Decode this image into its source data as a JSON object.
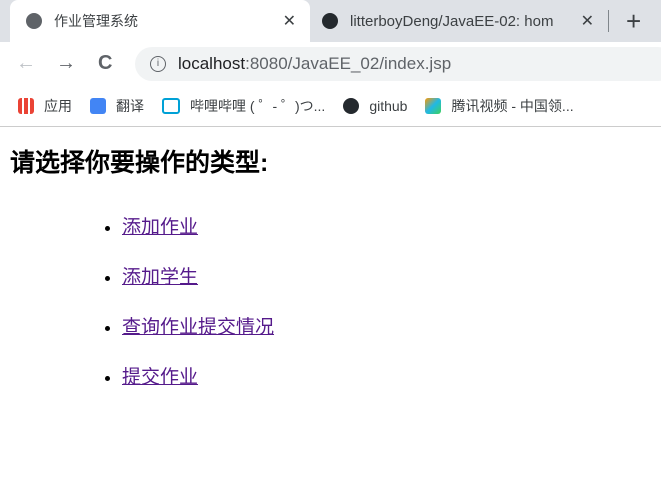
{
  "tabs": [
    {
      "title": "作业管理系统",
      "icon": "globe-icon",
      "active": true
    },
    {
      "title": "litterboyDeng/JavaEE-02: hom",
      "icon": "github-icon",
      "active": false
    }
  ],
  "toolbar": {
    "back": "←",
    "forward": "→",
    "reload": "C",
    "url_host": "localhost",
    "url_path": ":8080/JavaEE_02/index.jsp"
  },
  "bookmarks": [
    {
      "label": "应用",
      "icon": "apps-icon"
    },
    {
      "label": "翻译",
      "icon": "translate-icon"
    },
    {
      "label": "哔哩哔哩 ( ゜- ゜)つ...",
      "icon": "bilibili-icon"
    },
    {
      "label": "github",
      "icon": "github-icon"
    },
    {
      "label": "腾讯视频 - 中国领...",
      "icon": "tencent-video-icon"
    }
  ],
  "page": {
    "heading": "请选择你要操作的类型:",
    "links": [
      "添加作业",
      "添加学生",
      "查询作业提交情况",
      "提交作业"
    ]
  }
}
